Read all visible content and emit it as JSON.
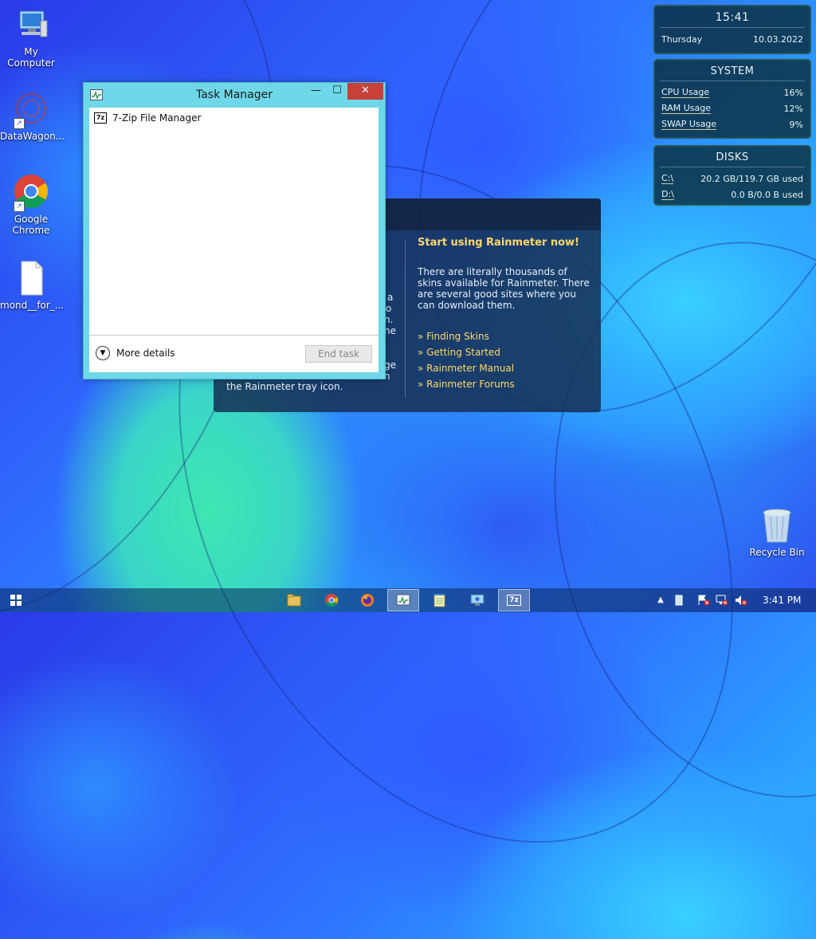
{
  "desktop": {
    "icons": [
      {
        "label": "My Computer"
      },
      {
        "label": "DataWagon..."
      },
      {
        "label": "Google Chrome"
      },
      {
        "label": "mond__for_..."
      },
      {
        "label": "Recycle Bin"
      }
    ]
  },
  "clock_widget": {
    "time": "15:41",
    "day": "Thursday",
    "date": "10.03.2022"
  },
  "system_widget": {
    "title": "SYSTEM",
    "rows": [
      {
        "label": "CPU Usage",
        "value": "16%"
      },
      {
        "label": "RAM Usage",
        "value": "12%"
      },
      {
        "label": "SWAP Usage",
        "value": "9%"
      }
    ]
  },
  "disks_widget": {
    "title": "DISKS",
    "rows": [
      {
        "label": "C:\\",
        "value": "20.2 GB/119.7 GB used"
      },
      {
        "label": "D:\\",
        "value": "0.0 B/0.0 B used"
      }
    ]
  },
  "welcome": {
    "heading": "Start using Rainmeter now!",
    "body": "There are literally thousands of skins available for Rainmeter. There are several good sites where you can download them.",
    "links": [
      "» Finding Skins",
      "» Getting Started",
      "» Rainmeter Manual",
      "» Rainmeter Forums"
    ],
    "left_fragments": [
      "a",
      "o",
      "n.",
      "ne",
      "ge",
      "n",
      "the Rainmeter tray icon."
    ]
  },
  "task_manager": {
    "title": "Task Manager",
    "minimize": "—",
    "maximize": "☐",
    "close": "✕",
    "processes": [
      {
        "name": "7-Zip File Manager",
        "icon_text": "7z"
      }
    ],
    "more_details": "More details",
    "end_task": "End task"
  },
  "taskbar": {
    "clock": "3:41 PM",
    "apps": [
      "file-explorer",
      "chrome",
      "firefox",
      "task-manager",
      "notepad",
      "remote-desktop",
      "7zip"
    ]
  }
}
